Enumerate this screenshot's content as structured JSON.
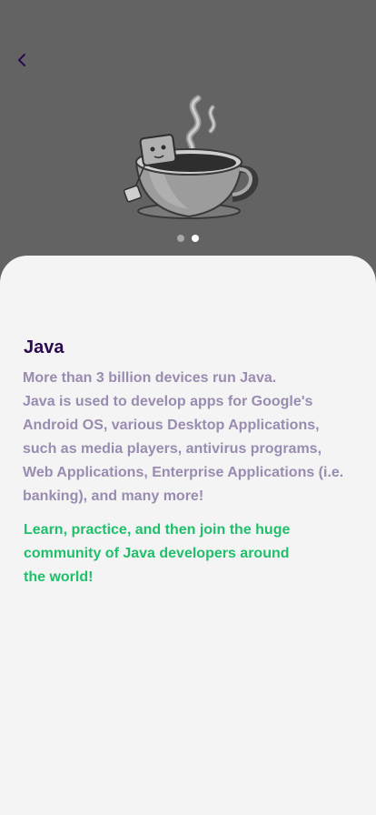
{
  "header": {
    "back_icon": "chevron-left-icon",
    "illustration_icon": "coffee-cup-icon"
  },
  "pager": {
    "total": 2,
    "active_index": 1
  },
  "content": {
    "title": "Java",
    "description": "More than 3 billion devices run Java.\nJava is used to develop apps for Google's\nAndroid OS, various Desktop Applications,\nsuch as media players, antivirus programs,\nWeb Applications, Enterprise Applications (i.e.\nbanking), and many more!",
    "call_to_action": "Learn, practice, and then join the huge\ncommunity of Java developers around\nthe world!"
  },
  "colors": {
    "top_background": "#636363",
    "sheet_background": "#f4f4f4",
    "title": "#2b0a4d",
    "description": "#9a8cb0",
    "accent": "#1fbf6b"
  }
}
